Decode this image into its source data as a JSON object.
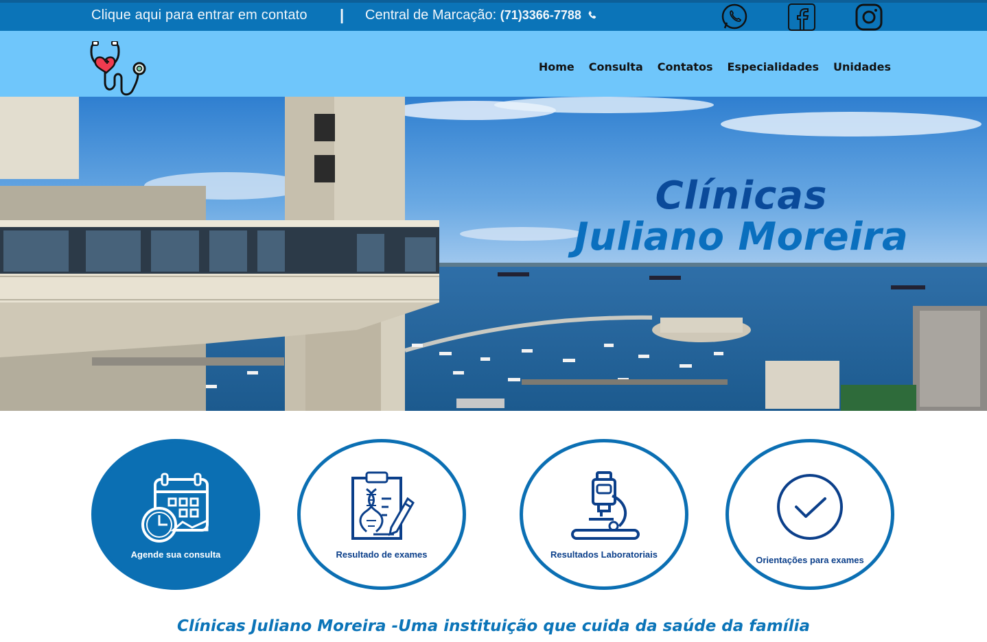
{
  "topbar": {
    "contact_label": "Clique aqui para  entrar em contato",
    "divider": "|",
    "central_label": "Central de Marcação:",
    "central_phone": "(71)3366-7788",
    "social": [
      {
        "name": "whatsapp-icon"
      },
      {
        "name": "facebook-icon"
      },
      {
        "name": "instagram-icon"
      }
    ]
  },
  "nav": {
    "items": [
      "Home",
      "Consulta",
      "Contatos",
      "Especialidades",
      "Unidades"
    ]
  },
  "hero": {
    "title_line1": "Clínicas",
    "title_line2": "Juliano Moreira"
  },
  "services": [
    {
      "label": "Agende sua consulta",
      "icon": "calendar-clock-icon",
      "active": true
    },
    {
      "label": "Resultado de exames",
      "icon": "clipboard-dna-icon",
      "active": false
    },
    {
      "label": "Resultados Laboratoriais",
      "icon": "microscope-icon",
      "active": false
    },
    {
      "label": "Orientações para exames",
      "icon": "check-circle-icon",
      "active": false
    }
  ],
  "tagline": "Clínicas Juliano Moreira -Uma instituição que cuida da saúde da família",
  "colors": {
    "topbar": "#0b74b8",
    "navbar": "#6fc6fb",
    "primary": "#0b6fb3",
    "hero_title_dark": "#0a4a9a"
  }
}
